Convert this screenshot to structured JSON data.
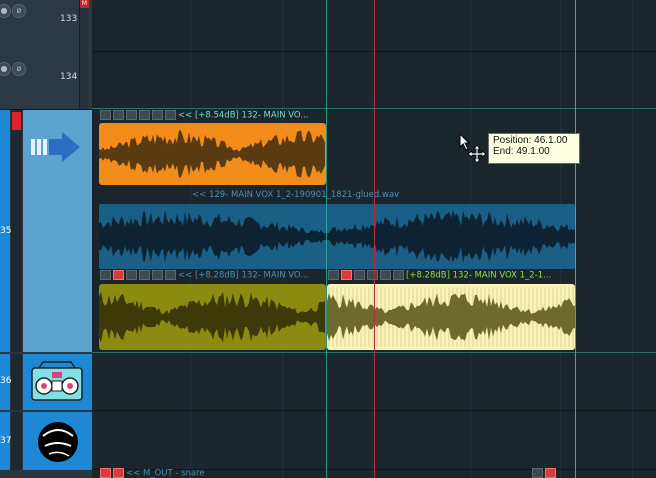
{
  "tracks": [
    {
      "number": "133",
      "icons": [
        "volume-icon",
        "phase-icon"
      ]
    },
    {
      "number": "134",
      "icons": [
        "volume-icon",
        "phase-icon"
      ]
    },
    {
      "number": "35"
    },
    {
      "number": "36"
    },
    {
      "number": "37"
    }
  ],
  "items": [
    {
      "label": "<< [+8.54dB] 132- MAIN VO...",
      "color": "#f28c1a"
    },
    {
      "label": "<< 129- MAIN VOX 1_2-190901_1821-glued.wav",
      "color": "#1a5f86"
    },
    {
      "label": "<< [+8.28dB] 132- MAIN VO...",
      "color": "#8c8a10"
    },
    {
      "label": "[+8.28dB] 132- MAIN VOX 1_2-1...",
      "color": "#faf3b7"
    },
    {
      "label": "<< M_OUT - snare",
      "color": "#1a252c"
    }
  ],
  "tooltip": {
    "position": "Position: 46.1.00",
    "end": "End: 49.1.00"
  },
  "colors": {
    "playhead": "#c0283a",
    "cursor_line": "#2fb0a0",
    "edit_line": "#4caf50",
    "accent_blue": "#1e88d4"
  }
}
